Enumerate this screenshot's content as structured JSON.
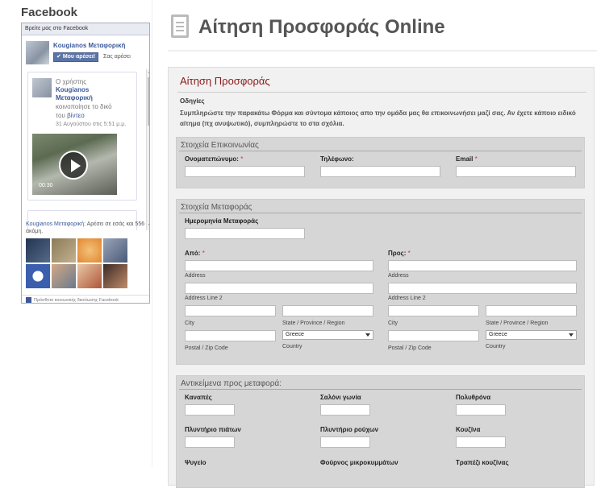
{
  "sidebar": {
    "title": "Facebook",
    "fb_header": "Βρείτε μας στο Facebook",
    "page_name": "Kougianos Μεταφορική",
    "like_button": "Μου αρέσει!",
    "like_label": "Σας αρέσει",
    "post": {
      "line1": "Ο χρήστης",
      "line2": "Kougianos",
      "line3": "Μεταφορική",
      "line4": "κοινοποίησε το δικό",
      "line5_prefix": "του ",
      "line5_link": "βίντεο",
      "date": "31 Αυγούστου στις 5:51 μ.μ.",
      "video_time": "00:30"
    },
    "friends_page": "Kougianos Μεταφορική",
    "friends_text": ": Αρέσει σε εσάς και 556 ακόμη.",
    "footer": "Πρόσθετο κοινωνικής δικτύωσης Facebook"
  },
  "main": {
    "title": "Αίτηση Προσφοράς Online",
    "form_title": "Αίτηση Προσφοράς",
    "instructions_heading": "Οδηγίες",
    "instructions_text": "Συμπληρώστε την παρακάτω Φόρμα και σύντομα κάποιος απο την ομάδα μας θα επικοινωνήσει μαζί σας. Αν έχετε κάποιο ειδικό αίτημα (πχ ανυψωτικό), συμπληρώστε το στα σχόλια."
  },
  "contact": {
    "title": "Στοιχεία Επικοινωνίας",
    "name_label": "Ονοματεπώνυμο:",
    "phone_label": "Τηλέφωνο:",
    "email_label": "Email",
    "req": "*"
  },
  "transport": {
    "title": "Στοιχεία Μεταφοράς",
    "date_label": "Ημερομηνία Μεταφοράς",
    "from_label": "Από:",
    "to_label": "Προς:",
    "req": "*",
    "address": "Address",
    "address2": "Address Line 2",
    "city": "City",
    "state": "State / Province / Region",
    "postal": "Postal / Zip Code",
    "country": "Country",
    "country_value": "Greece"
  },
  "items": {
    "title": "Αντικείμενα προς μεταφορά:",
    "labels": [
      "Καναπές",
      "Σαλόνι γωνία",
      "Πολυθρόνα",
      "Πλυντήριο πιάτων",
      "Πλυντήριο ρούχων",
      "Κουζίνα",
      "Ψυγείο",
      "Φούρνος μικροκυμμάτων",
      "Τραπέζι κουζίνας"
    ]
  },
  "colors": {
    "form_title": "#8b1a1a",
    "facebook_blue": "#3b5998",
    "section_bg": "#d6d6d6"
  }
}
